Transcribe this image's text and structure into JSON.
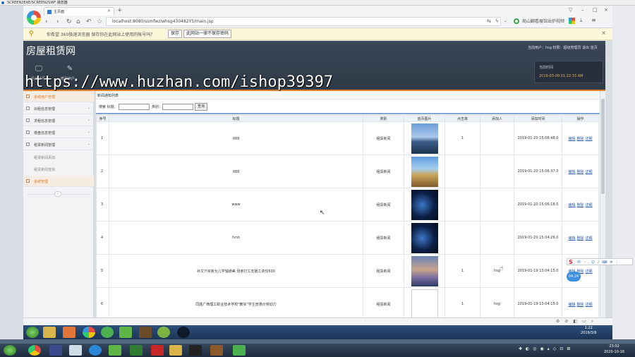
{
  "recorder": {
    "title": "SCREEN2EXE/SCREEN2SWF 播放器"
  },
  "browser": {
    "tab_label": "主页面",
    "url": "localhost:8080/ssmfwzlwhsg430482Y5/main.jsp",
    "url_right": "局山翻看展馆出炉视频",
    "password_prompt": "你希望 360极速浏览器 保存你在此网站上使用的帐号吗？",
    "save_label": "保存",
    "never_label": "此网站一律不保存密码"
  },
  "app": {
    "brand": "房屋租赁网",
    "user_line": "当前用户：hsg 权限：超级管理员  退出  首页",
    "header_icons": [
      {
        "label": "后台首页",
        "icon": "monitor-icon"
      },
      {
        "label": "修改用户",
        "icon": "pen-icon"
      }
    ],
    "time_label": "当前时间",
    "time_value": "2019-03-09 01:22:33 AM"
  },
  "watermark": "https://www.huzhan.com/ishop39397",
  "sidebar": {
    "items": [
      {
        "label": "系统用户管理",
        "active": true
      },
      {
        "label": "出租信息管理"
      },
      {
        "label": "求租信息管理"
      },
      {
        "label": "楼盘信息管理"
      },
      {
        "label": "租赁新闻管理"
      }
    ],
    "subs": [
      "租赁新闻添加",
      "租赁新闻查询"
    ],
    "system_item": "系统管理"
  },
  "content": {
    "title": "新闻通知列表",
    "search": {
      "title_label": "搜索 标题：",
      "category_label": "类别：",
      "button": "查询"
    },
    "columns": [
      "序号",
      "标题",
      "类别",
      "首页图片",
      "点击率",
      "添加人",
      "添加时间",
      "操作"
    ],
    "rows": [
      {
        "no": "1",
        "title": "ggg",
        "category": "租赁新闻",
        "clicks": "1",
        "adder": "",
        "time": "2019-01-20 15:06:48.0",
        "pic": "city"
      },
      {
        "no": "2",
        "title": "ggg",
        "category": "租赁新闻",
        "clicks": "",
        "adder": "",
        "time": "2019-01-20 15:06:37.0",
        "pic": "desert"
      },
      {
        "no": "3",
        "title": "www",
        "category": "租赁新闻",
        "clicks": "",
        "adder": "",
        "time": "2019-01-20 15:06:18.0",
        "pic": "tech"
      },
      {
        "no": "4",
        "title": "fvnh",
        "category": "租赁新闻",
        "clicks": "",
        "adder": "",
        "time": "2019-01-20 15:04:26.0",
        "pic": "tech"
      },
      {
        "no": "5",
        "title": "补文?!买房为儿学轴通美 母亲打工支援工资仅600",
        "category": "租赁新闻",
        "clicks": "1",
        "adder": "hsg",
        "time": "2019-01-19 13:04:15.0",
        "pic": "sky"
      },
      {
        "no": "6",
        "title": "同题广西理工职业技术学校\"教实\"学生普惠价劳动力",
        "category": "租赁新闻",
        "clicks": "1",
        "adder": "hsg",
        "time": "2019-01-19 13:04:15.0",
        "pic": "broken"
      }
    ],
    "ops": [
      "编辑",
      "删除",
      "详细"
    ]
  },
  "ime": {
    "logo": "S",
    "timer": "04:24"
  },
  "inner_clock": {
    "time": "1:22",
    "date": "2019/3/9"
  },
  "outer_clock": {
    "time": "23:02",
    "date": "2020-10-16"
  }
}
